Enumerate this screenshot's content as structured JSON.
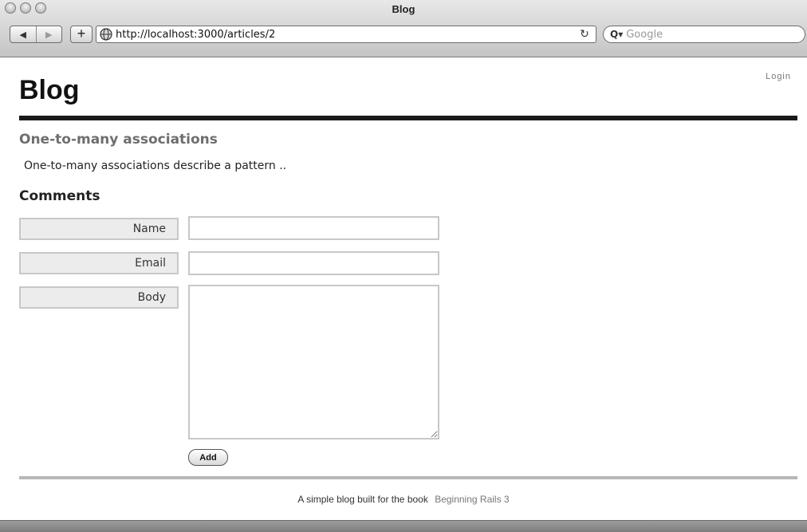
{
  "window": {
    "title": "Blog"
  },
  "toolbar": {
    "back_icon": "◀",
    "forward_icon": "▶",
    "add_label": "+",
    "url": "http://localhost:3000/articles/2",
    "reload_icon": "↻",
    "search_placeholder": "Google",
    "search_icon": "Q▾"
  },
  "header": {
    "site_title": "Blog",
    "login_label": "Login"
  },
  "article": {
    "title": "One-to-many associations",
    "body": "One-to-many associations describe a pattern .."
  },
  "comments": {
    "heading": "Comments",
    "name_label": "Name",
    "email_label": "Email",
    "body_label": "Body",
    "name_value": "",
    "email_value": "",
    "body_value": "",
    "submit_label": "Add"
  },
  "footer": {
    "text": "A simple blog built for the book",
    "link_text": "Beginning Rails 3"
  },
  "colors": {
    "rule_dark": "#1a1a1a",
    "rule_light": "#b7b7b7",
    "article_title": "#6e6e6e",
    "label_background": "#ececec",
    "input_border": "#c8c8c8"
  }
}
